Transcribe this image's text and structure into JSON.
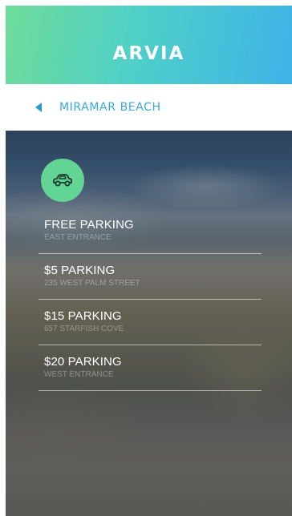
{
  "header": {
    "title": "ARVIA"
  },
  "nav": {
    "back_label": "MIRAMAR BEACH"
  },
  "icons": {
    "car": "car-icon",
    "back": "back-arrow-icon"
  },
  "colors": {
    "accent_green": "#62d493",
    "accent_blue": "#37a8e0"
  },
  "parking": [
    {
      "name": "FREE PARKING",
      "location": "EAST ENTRANCE"
    },
    {
      "name": "$5 PARKING",
      "location": "235 WEST PALM STREET"
    },
    {
      "name": "$15 PARKING",
      "location": "657 STARFISH COVE"
    },
    {
      "name": "$20 PARKING",
      "location": "WEST ENTRANCE"
    }
  ]
}
